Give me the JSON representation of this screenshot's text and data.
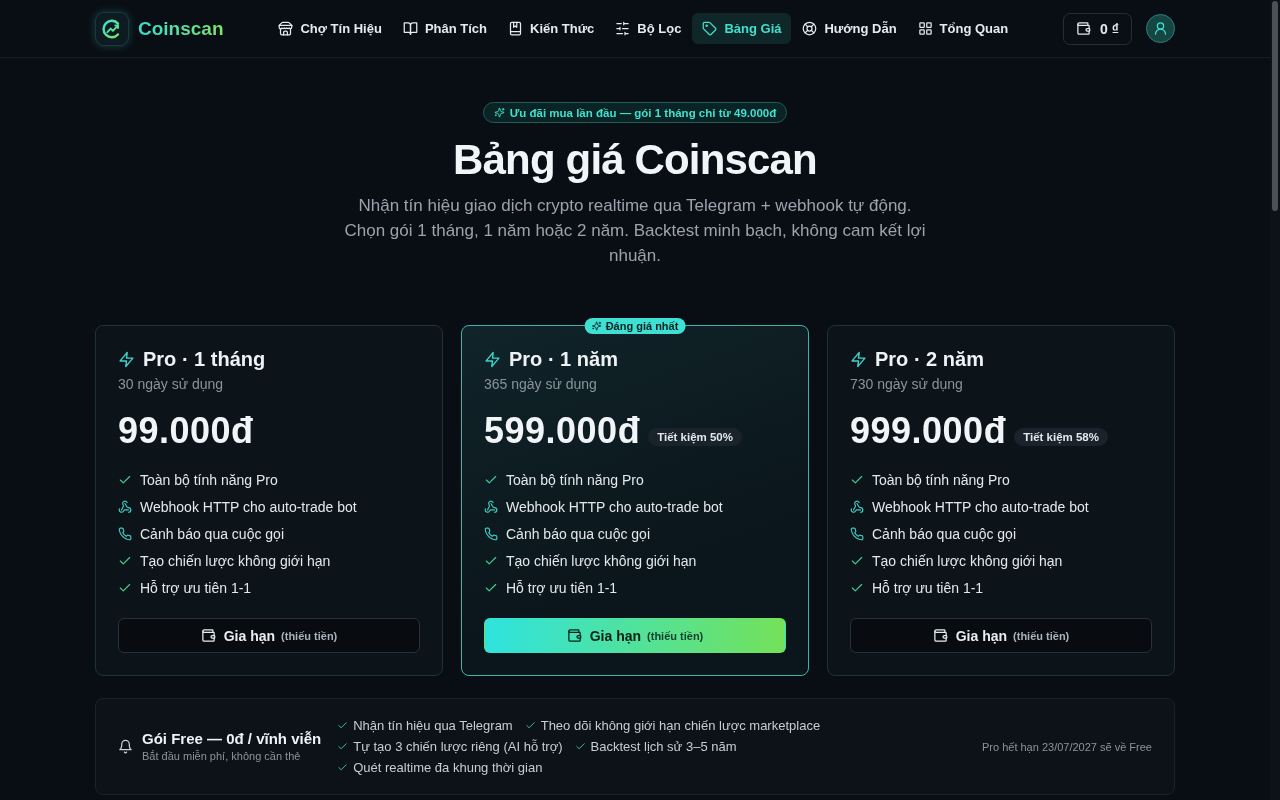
{
  "navbar": {
    "brand": "Coinscan",
    "items": [
      {
        "label": "Chợ Tín Hiệu",
        "selected": false
      },
      {
        "label": "Phân Tích",
        "selected": false
      },
      {
        "label": "Kiến Thức",
        "selected": false
      },
      {
        "label": "Bộ Lọc",
        "selected": false
      },
      {
        "label": "Bảng Giá",
        "selected": true
      },
      {
        "label": "Hướng Dẫn",
        "selected": false
      },
      {
        "label": "Tổng Quan",
        "selected": false
      }
    ],
    "wallet_balance": "0 ₫"
  },
  "hero": {
    "promo": "Ưu đãi mua lần đầu — gói 1 tháng chỉ từ 49.000đ",
    "title": "Bảng giá Coinscan",
    "subtitle": "Nhận tín hiệu giao dịch crypto realtime qua Telegram + webhook tự động. Chọn gói 1 tháng, 1 năm hoặc 2 năm. Backtest minh bạch, không cam kết lợi nhuận."
  },
  "plans": [
    {
      "name": "Pro · 1 tháng",
      "duration": "30 ngày sử dụng",
      "price": "99.000đ",
      "featured": false,
      "features": [
        "Toàn bộ tính năng Pro",
        "Webhook HTTP cho auto-trade bot",
        "Cảnh báo qua cuộc gọi",
        "Tạo chiến lược không giới hạn",
        "Hỗ trợ ưu tiên 1-1"
      ],
      "button": {
        "label": "Gia hạn",
        "note": "(thiếu tiền)"
      }
    },
    {
      "name": "Pro · 1 năm",
      "duration": "365 ngày sử dụng",
      "price": "599.000đ",
      "saving": "Tiết kiệm 50%",
      "featured": true,
      "badge": "Đáng giá nhất",
      "features": [
        "Toàn bộ tính năng Pro",
        "Webhook HTTP cho auto-trade bot",
        "Cảnh báo qua cuộc gọi",
        "Tạo chiến lược không giới hạn",
        "Hỗ trợ ưu tiên 1-1"
      ],
      "button": {
        "label": "Gia hạn",
        "note": "(thiếu tiền)"
      }
    },
    {
      "name": "Pro · 2 năm",
      "duration": "730 ngày sử dụng",
      "price": "999.000đ",
      "saving": "Tiết kiệm 58%",
      "featured": false,
      "features": [
        "Toàn bộ tính năng Pro",
        "Webhook HTTP cho auto-trade bot",
        "Cảnh báo qua cuộc gọi",
        "Tạo chiến lược không giới hạn",
        "Hỗ trợ ưu tiên 1-1"
      ],
      "button": {
        "label": "Gia hạn",
        "note": "(thiếu tiền)"
      }
    }
  ],
  "free_plan": {
    "title": "Gói Free — 0đ / vĩnh viễn",
    "subtitle": "Bắt đầu miễn phí, không cần thẻ",
    "features": [
      "Nhận tín hiệu qua Telegram",
      "Theo dõi không giới hạn chiến lược marketplace",
      "Tự tạo 3 chiến lược riêng (AI hỗ trợ)",
      "Backtest lịch sử 3–5 năm",
      "Quét realtime đa khung thời gian"
    ],
    "note": "Pro hết hạn 23/07/2027 sẽ về Free"
  }
}
